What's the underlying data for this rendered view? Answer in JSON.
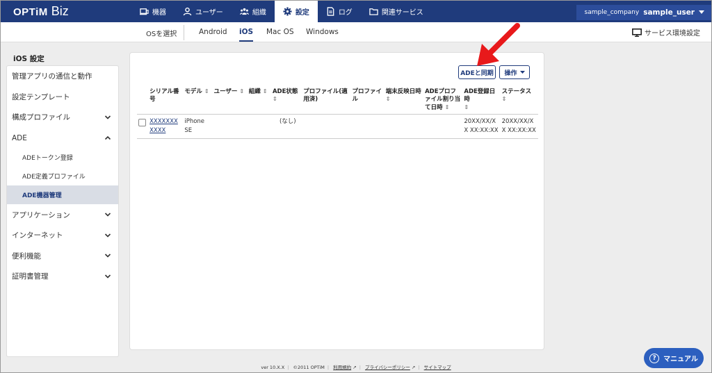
{
  "header": {
    "logo_main": "OPTiM",
    "logo_sub": "Biz",
    "nav": [
      {
        "label": "機器",
        "icon": "devices-icon"
      },
      {
        "label": "ユーザー",
        "icon": "user-icon"
      },
      {
        "label": "組織",
        "icon": "organization-icon"
      },
      {
        "label": "設定",
        "icon": "gear-icon"
      },
      {
        "label": "ログ",
        "icon": "log-icon"
      },
      {
        "label": "関連サービス",
        "icon": "folder-icon"
      }
    ],
    "company": "sample_company",
    "user": "sample_user"
  },
  "os_bar": {
    "select_label": "OSを選択",
    "tabs": [
      "Android",
      "iOS",
      "Mac OS",
      "Windows"
    ],
    "active_tab": "iOS",
    "service_env": "サービス環境設定"
  },
  "sidebar": {
    "title": "iOS 設定",
    "items": [
      {
        "label": "管理アプリの通信と動作"
      },
      {
        "label": "設定テンプレート"
      },
      {
        "label": "構成プロファイル",
        "chevron": "down"
      },
      {
        "label": "ADE",
        "chevron": "up"
      },
      {
        "label": "ADEトークン登録"
      },
      {
        "label": "ADE定義プロファイル"
      },
      {
        "label": "ADE機器管理"
      },
      {
        "label": "アプリケーション",
        "chevron": "down"
      },
      {
        "label": "インターネット",
        "chevron": "down"
      },
      {
        "label": "便利機能",
        "chevron": "down"
      },
      {
        "label": "証明書管理",
        "chevron": "down"
      }
    ]
  },
  "main": {
    "sync_button": "ADEと同期",
    "operate_button": "操作",
    "columns": [
      "シリアル番号",
      "モデル",
      "ユーザー",
      "組織",
      "ADE状態",
      "プロファイル(適用済)",
      "プロファイル",
      "端末反映日時",
      "ADEプロファイル割り当て日時",
      "ADE登録日時",
      "ステータス"
    ],
    "rows": [
      {
        "serial": "XXXXXXXXXXX",
        "model": "iPhone SE",
        "user": "",
        "org": "",
        "ade_state": "(なし)",
        "profile_applied": "",
        "profile": "",
        "reflected": "",
        "assigned": "",
        "registered": "20XX/XX/XX XX:XX:XX",
        "status": "20XX/XX/XX XX:XX:XX"
      }
    ]
  },
  "footer": {
    "version": "ver 10.X.X",
    "copyright": "©2011 OPTiM",
    "terms": "利用規約",
    "privacy": "プライバシーポリシー",
    "sitemap": "サイトマップ"
  },
  "manual_button": "マニュアル",
  "accent": "#1f3b7c",
  "annotation_arrow_color": "#e8191b"
}
